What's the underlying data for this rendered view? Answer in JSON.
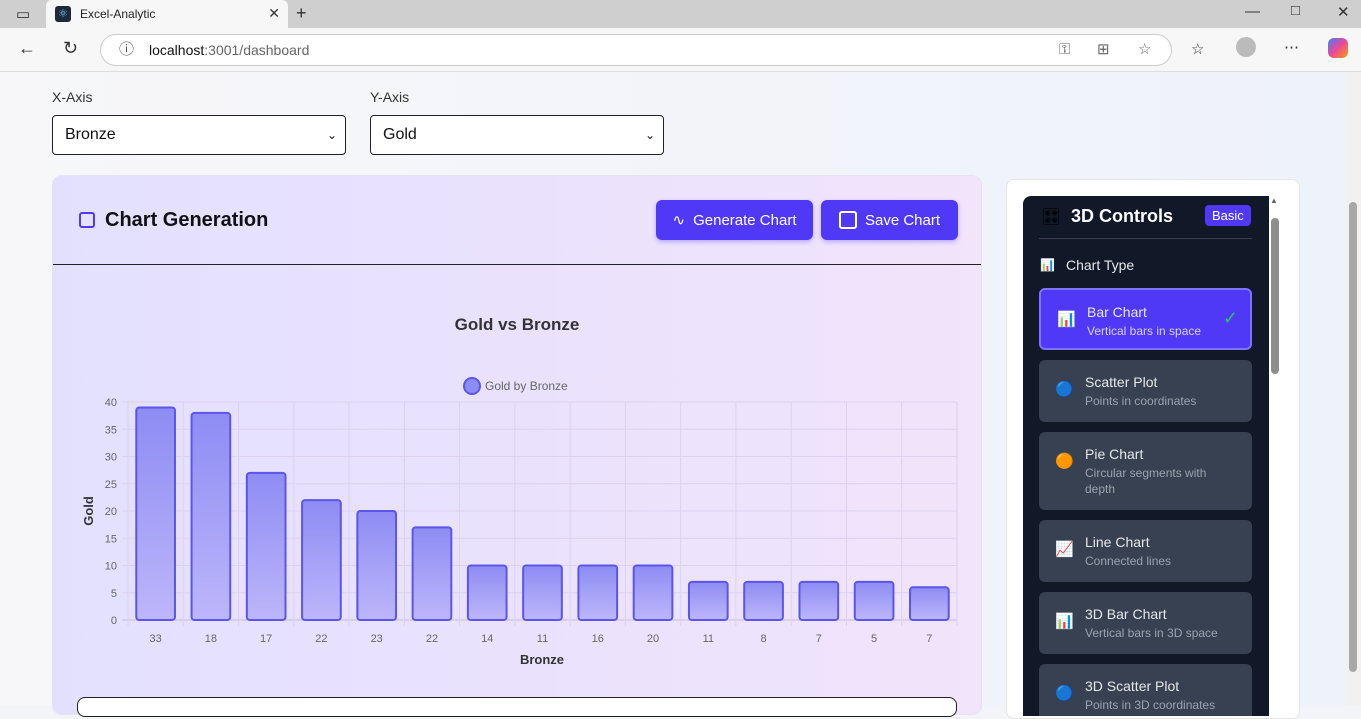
{
  "browser": {
    "tab_title": "Excel-Analytic",
    "url_host": "localhost",
    "url_path": ":3001/dashboard"
  },
  "axes": {
    "x_label": "X-Axis",
    "x_value": "Bronze",
    "y_label": "Y-Axis",
    "y_value": "Gold"
  },
  "card": {
    "title": "Chart Generation",
    "generate_label": "Generate Chart",
    "save_label": "Save Chart"
  },
  "controls": {
    "title": "3D Controls",
    "badge": "Basic",
    "section": "Chart Type",
    "options": [
      {
        "title": "Bar Chart",
        "desc": "Vertical bars in space",
        "icon": "bar-chart-icon"
      },
      {
        "title": "Scatter Plot",
        "desc": "Points in coordinates",
        "icon": "sphere-icon"
      },
      {
        "title": "Pie Chart",
        "desc": "Circular segments with depth",
        "icon": "pie-icon"
      },
      {
        "title": "Line Chart",
        "desc": "Connected lines",
        "icon": "line-chart-icon"
      },
      {
        "title": "3D Bar Chart",
        "desc": "Vertical bars in 3D space",
        "icon": "bar-chart-icon"
      },
      {
        "title": "3D Scatter Plot",
        "desc": "Points in 3D coordinates",
        "icon": "sphere-icon"
      }
    ],
    "selected": "Bar Chart"
  },
  "chart_data": {
    "type": "bar",
    "title": "Gold vs Bronze",
    "legend": "Gold by Bronze",
    "legend_position": "top",
    "xlabel": "Bronze",
    "ylabel": "Gold",
    "ylim": [
      0,
      40
    ],
    "yticks": [
      0,
      5,
      10,
      15,
      20,
      25,
      30,
      35,
      40
    ],
    "grid": true,
    "categories": [
      "33",
      "18",
      "17",
      "22",
      "23",
      "22",
      "14",
      "11",
      "16",
      "20",
      "11",
      "8",
      "7",
      "5",
      "7"
    ],
    "values": [
      39,
      38,
      27,
      22,
      20,
      17,
      10,
      10,
      10,
      10,
      7,
      7,
      7,
      7,
      6
    ],
    "colors": {
      "fill": "#8b87f3",
      "stroke": "#5b55ec"
    }
  }
}
